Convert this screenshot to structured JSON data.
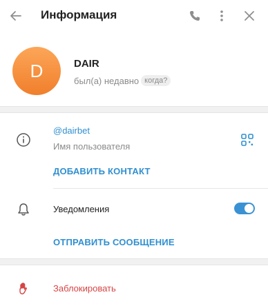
{
  "header": {
    "title": "Информация",
    "back_icon": "arrow-left-icon",
    "call_icon": "phone-icon",
    "menu_icon": "more-vertical-icon",
    "close_icon": "close-icon"
  },
  "profile": {
    "avatar_letter": "D",
    "avatar_color": "#f5913f",
    "name": "DAIR",
    "status": "был(а) недавно",
    "when_label": "когда?"
  },
  "info": {
    "username": "@dairbet",
    "username_caption": "Имя пользователя",
    "add_contact": "ДОБАВИТЬ КОНТАКТ",
    "info_icon": "info-icon",
    "qr_icon": "qr-code-icon"
  },
  "notifications": {
    "label": "Уведомления",
    "enabled": true,
    "bell_icon": "bell-icon"
  },
  "actions": {
    "send_message": "ОТПРАВИТЬ СООБЩЕНИЕ",
    "block": "Заблокировать",
    "block_icon": "stop-hand-icon"
  },
  "colors": {
    "accent": "#2f8fd0",
    "danger": "#d64545",
    "muted": "#8a8a8a"
  }
}
